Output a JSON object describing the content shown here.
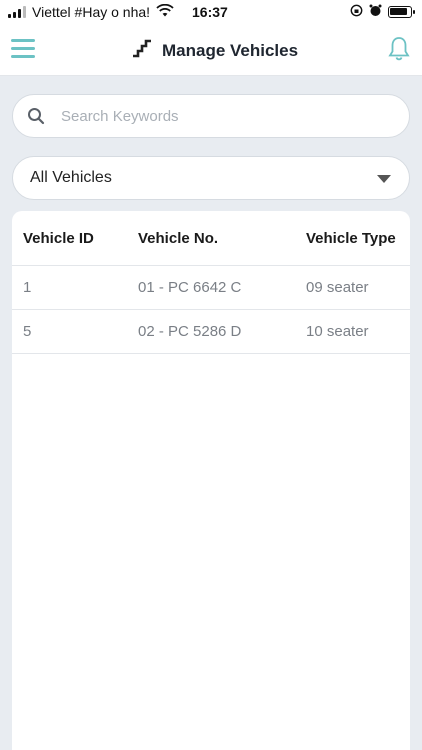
{
  "status_bar": {
    "carrier": "Viettel #Hay o nha!",
    "time": "16:37"
  },
  "header": {
    "title": "Manage Vehicles",
    "menu_icon": "hamburger-menu-icon",
    "title_icon": "stairs-icon",
    "notification_icon": "bell-icon",
    "accent_color": "#6cc2c4"
  },
  "search": {
    "placeholder": "Search Keywords",
    "value": ""
  },
  "filter": {
    "selected": "All Vehicles"
  },
  "table": {
    "columns": [
      "Vehicle ID",
      "Vehicle No.",
      "Vehicle Type"
    ],
    "rows": [
      {
        "id": "1",
        "number": "01 - PC 6642 C",
        "type": "09 seater"
      },
      {
        "id": "5",
        "number": "02 - PC 5286 D",
        "type": "10 seater"
      }
    ]
  }
}
